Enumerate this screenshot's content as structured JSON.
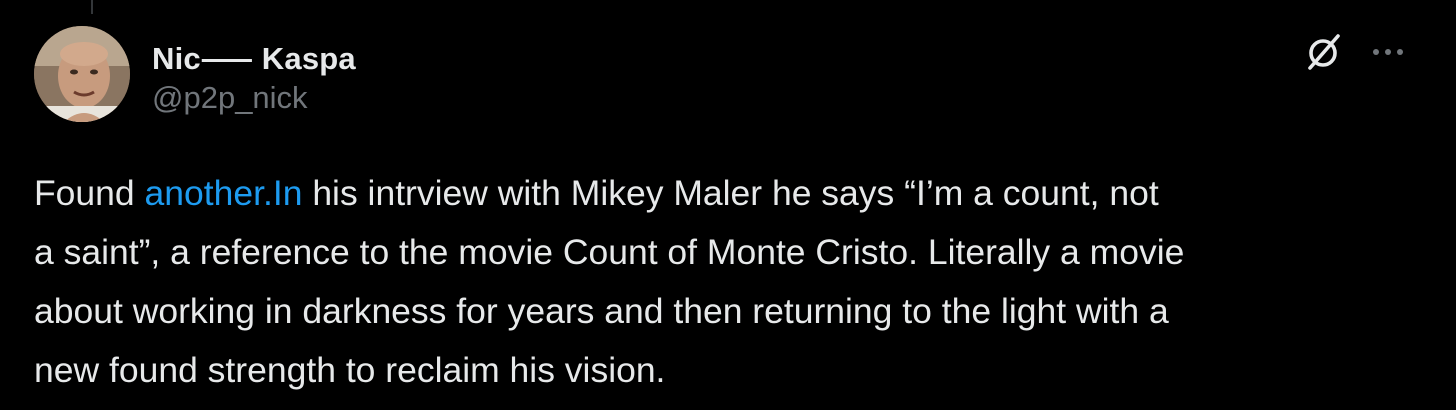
{
  "author": {
    "display_name": "Nic⸺ Kaspa",
    "handle": "@p2p_nick",
    "avatar": "avatar-photo"
  },
  "icons": {
    "grok": "grok-slash-circle-icon",
    "more": "more-options-icon"
  },
  "tweet": {
    "line1_before_link": "Found ",
    "link_text": "another.In",
    "line1_after_link": " his intrview with Mikey Maler he says “I’m a count, not",
    "line2": "a saint”, a reference to the movie Count of Monte Cristo. Literally a movie",
    "line3": "about working in darkness for years and then returning to the light with a",
    "line4": "new found strength to reclaim his vision."
  },
  "colors": {
    "background": "#000000",
    "text_primary": "#e7e9ea",
    "text_secondary": "#71767b",
    "link": "#1d9bf0"
  }
}
